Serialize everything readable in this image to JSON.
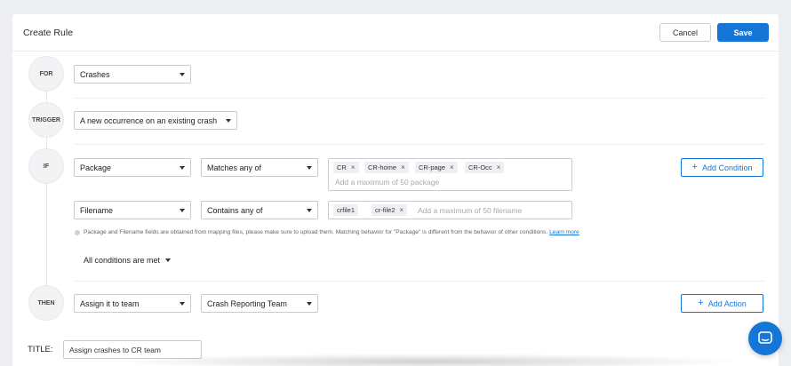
{
  "header": {
    "title": "Create Rule",
    "cancel_label": "Cancel",
    "save_label": "Save"
  },
  "steps": {
    "for": "FOR",
    "trigger": "TRIGGER",
    "if": "IF",
    "then": "THEN"
  },
  "for_select": "Crashes",
  "trigger_select": "A new occurrence on an existing crash",
  "conditions": [
    {
      "field": "Package",
      "operator": "Matches any of",
      "tags": [
        "CR",
        "CR-home",
        "CR-page",
        "CR-Occ"
      ],
      "placeholder": "Add a maximum of 50 package"
    },
    {
      "field": "Filename",
      "operator": "Contains any of",
      "tags": [
        "crfile1",
        "cr-file2"
      ],
      "placeholder": "Add a maximum of 50 filename"
    }
  ],
  "add_condition_label": "Add Condition",
  "note": {
    "text": "Package and Filename fields are obtained from mapping files, please make sure to upload them. Matching behavior for \"Package\" is different from the behavior of other conditions.",
    "link": "Learn more"
  },
  "conditions_mode": "All conditions are met",
  "then": {
    "action": "Assign it to team",
    "team": "Crash Reporting Team",
    "add_action_label": "Add Action"
  },
  "title_field": {
    "label": "TITLE:",
    "value": "Assign crashes to CR team"
  },
  "icons": {
    "chat": "chat-bubble-icon",
    "remove": "close-icon",
    "dropdown": "chevron-down-icon"
  },
  "colors": {
    "accent": "#1676d8"
  }
}
